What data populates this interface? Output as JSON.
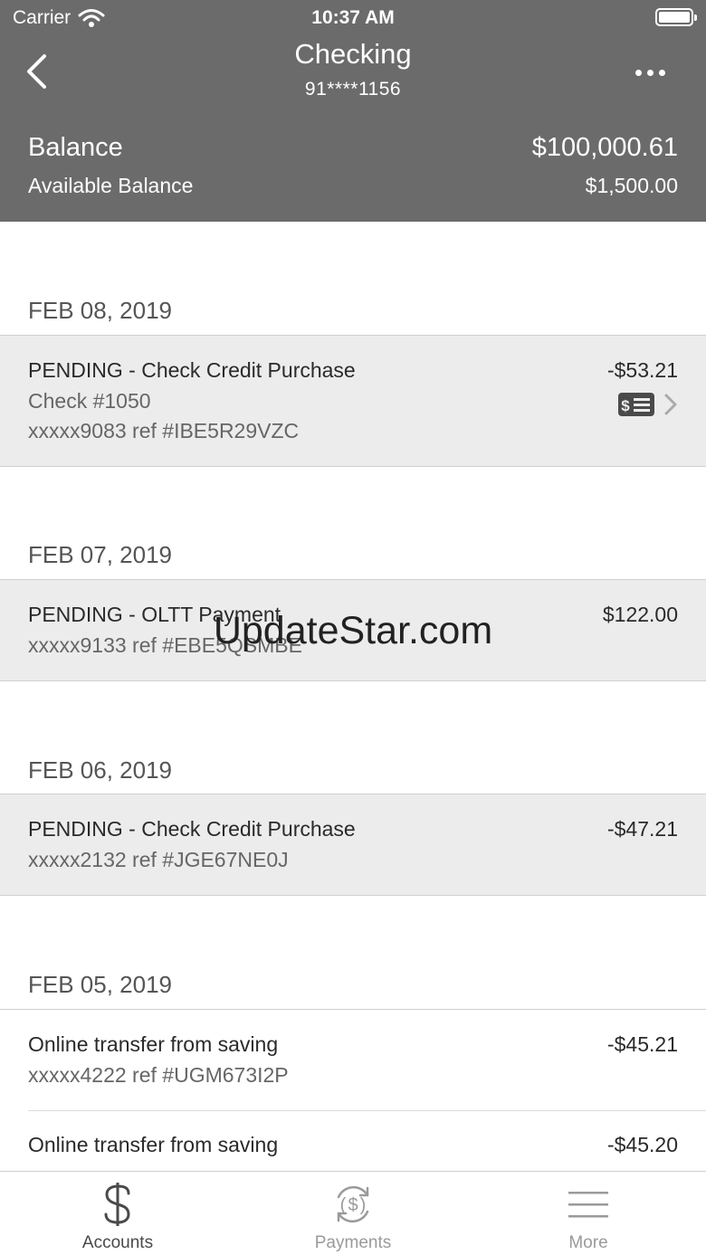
{
  "status_bar": {
    "carrier": "Carrier",
    "time": "10:37 AM"
  },
  "header": {
    "title": "Checking",
    "account_number": "91****1156",
    "balance_label": "Balance",
    "balance_value": "$100,000.61",
    "available_label": "Available Balance",
    "available_value": "$1,500.00"
  },
  "groups": [
    {
      "date": "FEB 08, 2019",
      "items": [
        {
          "title": "PENDING - Check Credit Purchase",
          "line2": "Check #1050",
          "line3": "xxxxx9083 ref #IBE5R29VZC",
          "amount": "-$53.21",
          "icon": "check-icon"
        }
      ]
    },
    {
      "date": "FEB 07, 2019",
      "items": [
        {
          "title": "PENDING - OLTT Payment",
          "line2": "xxxxx9133 ref #EBE5QSMBE",
          "amount": "$122.00"
        }
      ]
    },
    {
      "date": "FEB 06, 2019",
      "items": [
        {
          "title": "PENDING - Check Credit Purchase",
          "line2": "xxxxx2132 ref #JGE67NE0J",
          "amount": "-$47.21"
        }
      ]
    },
    {
      "date": "FEB 05, 2019",
      "items": [
        {
          "title": "Online transfer from saving",
          "line2": "xxxxx4222 ref #UGM673I2P",
          "amount": "-$45.21"
        },
        {
          "title": "Online transfer from saving",
          "amount": "-$45.20"
        }
      ]
    }
  ],
  "watermark": "UpdateStar.com",
  "tabbar": {
    "tabs": [
      {
        "label": "Accounts",
        "icon": "dollar-icon",
        "active": true
      },
      {
        "label": "Payments",
        "icon": "payments-icon",
        "active": false
      },
      {
        "label": "More",
        "icon": "menu-icon",
        "active": false
      }
    ]
  },
  "colors": {
    "header_bg": "#6b6b6b",
    "pending_row_bg": "#ececec",
    "tab_active": "#4a4a4a",
    "tab_inactive": "#9a9a9a"
  }
}
